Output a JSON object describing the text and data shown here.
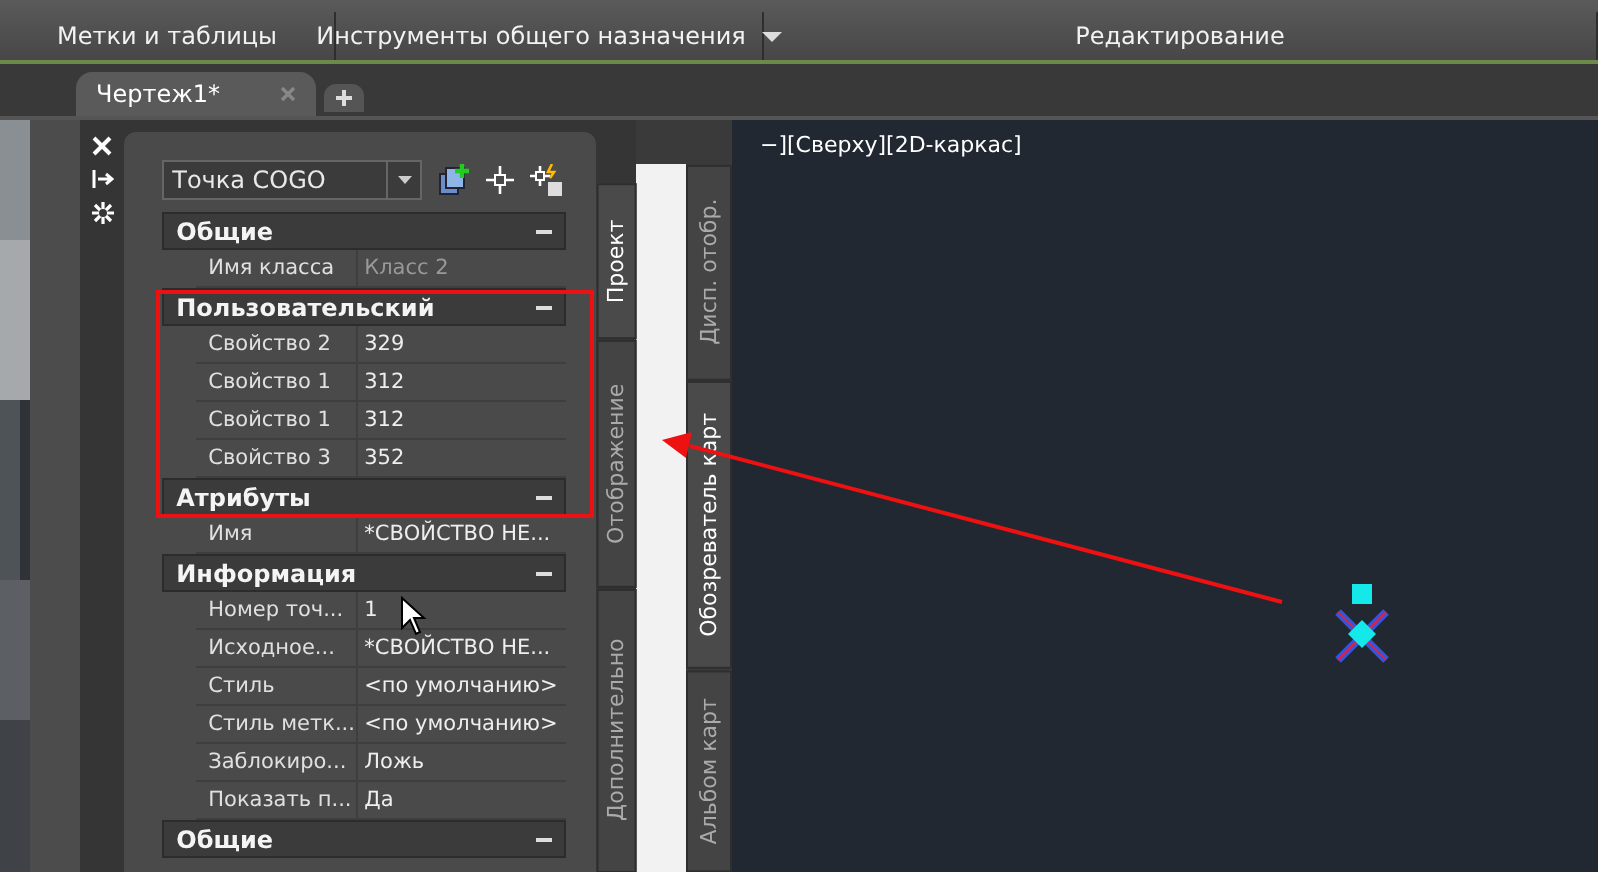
{
  "ribbon": {
    "panels": [
      {
        "label": "Метки и таблицы",
        "has_menu": false
      },
      {
        "label": "Инструменты общего назначения",
        "has_menu": true
      },
      {
        "label": "Редактирование",
        "has_menu": false
      }
    ]
  },
  "document_tabs": [
    {
      "label": "Чертеж1*",
      "selected": true
    }
  ],
  "palette": {
    "object_type": "Точка COGO",
    "sections": [
      {
        "title": "Общие",
        "expanded": true,
        "rows": [
          {
            "name": "Имя класса",
            "value": "Класс 2",
            "disabled": true
          }
        ]
      },
      {
        "title": "Пользовательский",
        "expanded": true,
        "rows": [
          {
            "name": "Свойство 2",
            "value": "329",
            "disabled": false
          },
          {
            "name": "Свойство 1",
            "value": "312",
            "disabled": false
          },
          {
            "name": "Свойство 1",
            "value": "312",
            "disabled": false
          },
          {
            "name": "Свойство 3",
            "value": "352",
            "disabled": false
          }
        ]
      },
      {
        "title": "Атрибуты",
        "expanded": true,
        "rows": [
          {
            "name": "Имя",
            "value": "*СВОЙСТВО НЕ...",
            "disabled": false
          }
        ]
      },
      {
        "title": "Информация",
        "expanded": true,
        "rows": [
          {
            "name": "Номер точ...",
            "value": "1",
            "disabled": false
          },
          {
            "name": "Исходное...",
            "value": "*СВОЙСТВО НЕ...",
            "disabled": false
          },
          {
            "name": "Стиль",
            "value": "<по умолчанию>",
            "disabled": false
          },
          {
            "name": "Стиль  метк...",
            "value": "<по умолчанию>",
            "disabled": false
          },
          {
            "name": "Заблокиро...",
            "value": "Ложь",
            "disabled": false
          },
          {
            "name": "Показать  п...",
            "value": "Да",
            "disabled": false
          }
        ]
      },
      {
        "title": "Общие",
        "expanded": true
      }
    ],
    "tabs": [
      {
        "label": "Проект",
        "selected": true
      },
      {
        "label": "Отображение",
        "selected": false
      },
      {
        "label": "Дополнительно",
        "selected": false
      }
    ]
  },
  "outer_tabs": [
    {
      "label": "Дисп. отобр.",
      "selected": false
    },
    {
      "label": "Обозреватель карт",
      "selected": true
    },
    {
      "label": "Альбом карт",
      "selected": false
    }
  ],
  "viewport": {
    "label": "−][Сверху][2D-каркас]"
  }
}
